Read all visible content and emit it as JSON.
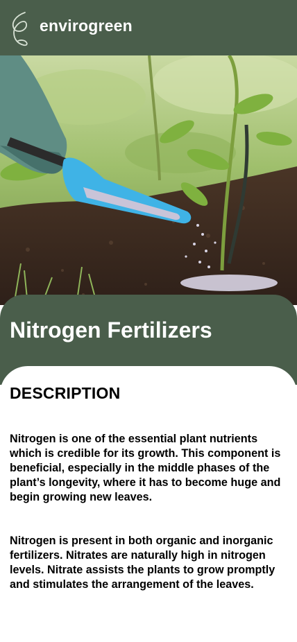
{
  "header": {
    "brand": "envirogreen",
    "logo_icon": "leaf-outline-icon",
    "background_color": "#4a5e4b"
  },
  "hero": {
    "image_description": "gloved hand pouring fertilizer granules from a blue scoop onto soil beside a young plant"
  },
  "article": {
    "title": "Nitrogen Fertilizers",
    "section_heading": "DESCRIPTION",
    "paragraphs": [
      "Nitrogen is one of the essential plant nutrients which is credible for its growth. This component is beneficial, especially in the middle phases of the plant’s longevity, where it has to become huge and begin growing new leaves.",
      "Nitrogen is present in both organic and inorganic fertilizers. Nitrates are naturally high in nitrogen levels. Nitrate assists the plants to grow promptly and stimulates the arrangement of the leaves."
    ]
  },
  "colors": {
    "accent": "#4a5e4b",
    "scoop": "#3fb3e6",
    "soil": "#3b2a20"
  }
}
